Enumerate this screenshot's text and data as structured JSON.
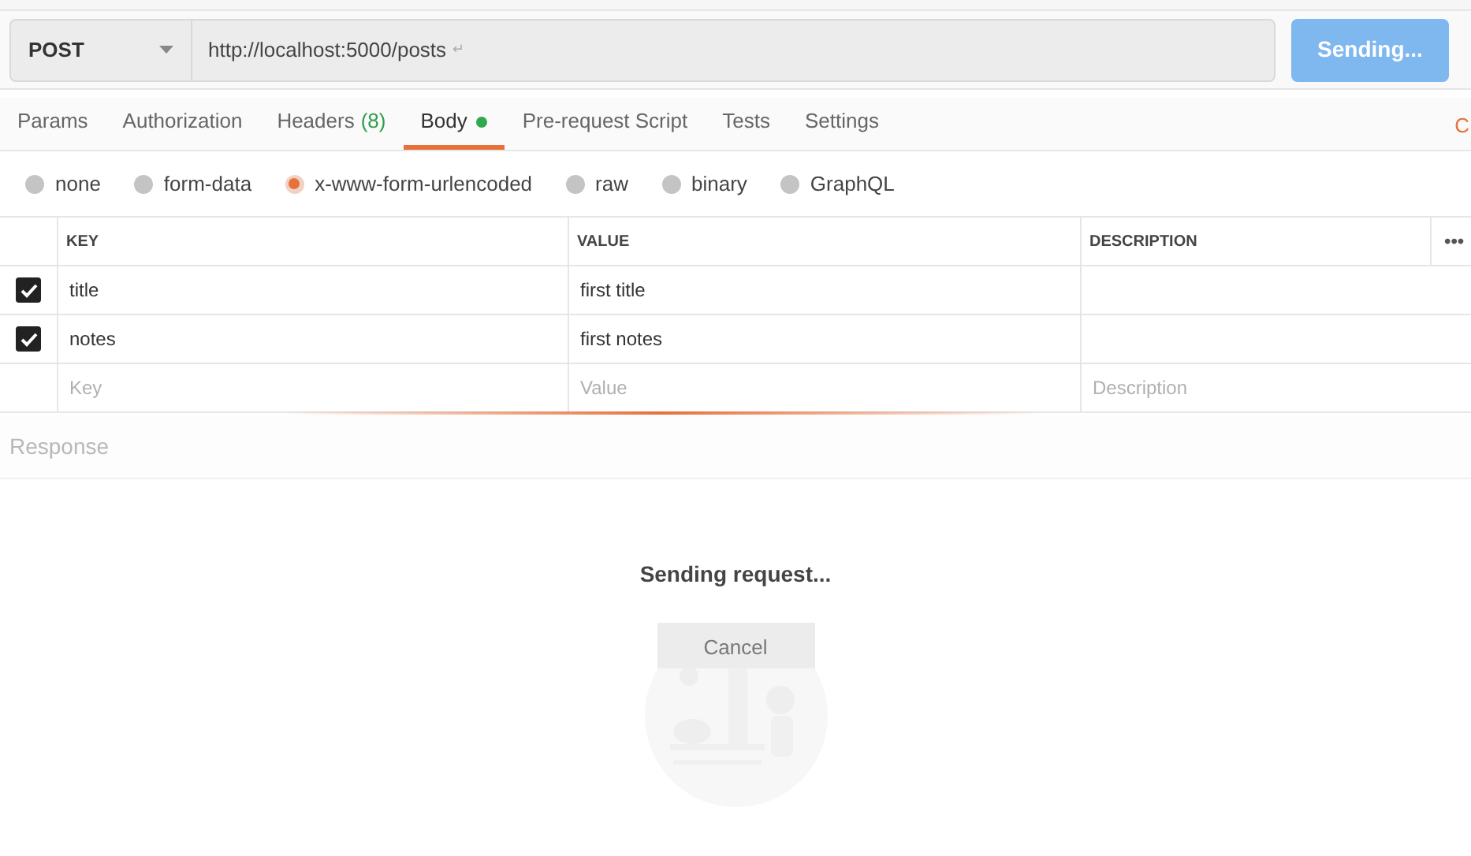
{
  "request": {
    "method": "POST",
    "url": "http://localhost:5000/posts",
    "url_mark": "↵",
    "send_button": "Sending..."
  },
  "tabs": [
    {
      "label": "Params",
      "selected": false
    },
    {
      "label": "Authorization",
      "selected": false
    },
    {
      "label": "Headers",
      "count": "(8)",
      "selected": false
    },
    {
      "label": "Body",
      "dot": true,
      "selected": true
    },
    {
      "label": "Pre-request Script",
      "selected": false
    },
    {
      "label": "Tests",
      "selected": false
    },
    {
      "label": "Settings",
      "selected": false
    }
  ],
  "tabs_right_link": "C",
  "body_types": [
    {
      "label": "none",
      "selected": false
    },
    {
      "label": "form-data",
      "selected": false
    },
    {
      "label": "x-www-form-urlencoded",
      "selected": true
    },
    {
      "label": "raw",
      "selected": false
    },
    {
      "label": "binary",
      "selected": false
    },
    {
      "label": "GraphQL",
      "selected": false
    }
  ],
  "table": {
    "columns": [
      "KEY",
      "VALUE",
      "DESCRIPTION"
    ],
    "menu": "•••",
    "rows": [
      {
        "checked": true,
        "key": "title",
        "value": "first title"
      },
      {
        "checked": true,
        "key": "notes",
        "value": "first notes"
      }
    ],
    "placeholders": {
      "key": "Key",
      "value": "Value",
      "description": "Description"
    }
  },
  "response": {
    "title": "Response",
    "status": "Sending request...",
    "cancel_button": "Cancel"
  }
}
